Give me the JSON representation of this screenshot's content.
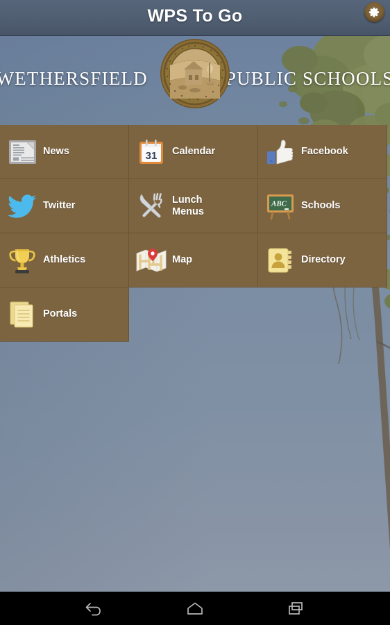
{
  "app": {
    "title": "WPS To Go",
    "settings_icon": "gear-icon"
  },
  "banner": {
    "left_text": "WETHERSFIELD",
    "right_text": "PUBLIC SCHOOLS",
    "seal_icon": "town-seal-icon"
  },
  "colors": {
    "titlebar": "#4f5d70",
    "tile_background": "#7d6441",
    "tile_divider": "#6a5438",
    "tile_label": "#ffffff",
    "sky": "#7b8da3",
    "navbar": "#000000"
  },
  "grid": {
    "tiles": [
      {
        "label": "News",
        "icon": "newspaper-icon"
      },
      {
        "label": "Calendar",
        "icon": "calendar-icon"
      },
      {
        "label": "Facebook",
        "icon": "facebook-thumbs-up-icon"
      },
      {
        "label": "Twitter",
        "icon": "twitter-bird-icon"
      },
      {
        "label": "Lunch\nMenus",
        "icon": "fork-knife-icon"
      },
      {
        "label": "Schools",
        "icon": "chalkboard-abc-icon"
      },
      {
        "label": "Athletics",
        "icon": "trophy-icon"
      },
      {
        "label": "Map",
        "icon": "folded-map-pin-icon"
      },
      {
        "label": "Directory",
        "icon": "address-book-icon"
      },
      {
        "label": "Portals",
        "icon": "documents-icon"
      }
    ]
  },
  "calendar_icon": {
    "day_number": "31"
  },
  "chalkboard_icon": {
    "text": "ABC"
  },
  "navbar": {
    "buttons": [
      {
        "label": "Back",
        "icon": "back-arrow-icon"
      },
      {
        "label": "Home",
        "icon": "home-icon"
      },
      {
        "label": "Recents",
        "icon": "recent-apps-icon"
      }
    ]
  }
}
